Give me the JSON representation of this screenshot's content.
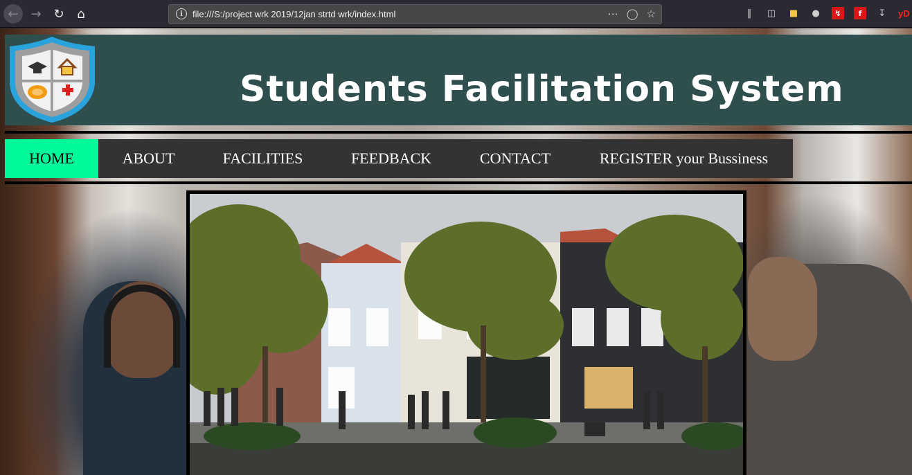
{
  "browser": {
    "url": "file:///S:/project wrk 2019/12jan strtd wrk/index.html",
    "toolbar_right_label": "yD"
  },
  "site": {
    "title": "Students Facilitation System",
    "colors": {
      "header_bg": "#2f4f4f",
      "menu_bg": "#333333",
      "menu_active_bg": "#00fa9a"
    }
  },
  "menu": {
    "items": [
      {
        "label": "HOME",
        "active": true
      },
      {
        "label": "ABOUT",
        "active": false
      },
      {
        "label": "FACILITIES",
        "active": false
      },
      {
        "label": "FEEDBACK",
        "active": false
      },
      {
        "label": "CONTACT",
        "active": false
      },
      {
        "label": "REGISTER your Bussiness",
        "active": false
      }
    ]
  },
  "icons": {
    "shield_quadrants": [
      "graduation-cap-icon",
      "house-icon",
      "plate-icon",
      "medical-cross-icon"
    ]
  }
}
